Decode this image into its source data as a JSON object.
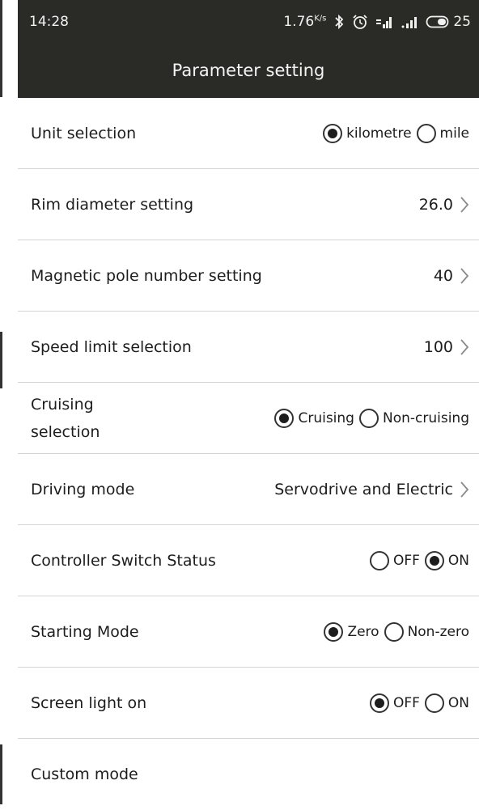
{
  "status_bar": {
    "time": "14:28",
    "speed": "1.76",
    "speed_unit": "K/s",
    "battery": "25",
    "icons": [
      "bluetooth-icon",
      "alarm-icon",
      "signal-icon",
      "signal-icon",
      "battery-icon"
    ]
  },
  "header": {
    "title": "Parameter setting"
  },
  "settings": {
    "unit": {
      "label": "Unit selection",
      "options": [
        "kilometre",
        "mile"
      ],
      "selected": "kilometre"
    },
    "rim": {
      "label": "Rim diameter setting",
      "value": "26.0"
    },
    "pole": {
      "label": "Magnetic pole number setting",
      "value": "40"
    },
    "speed": {
      "label": "Speed limit selection",
      "value": "100"
    },
    "cruise": {
      "label_line1": "Cruising",
      "label_line2": "selection",
      "options": [
        "Cruising",
        "Non-cruising"
      ],
      "selected": "Cruising"
    },
    "driving": {
      "label": "Driving mode",
      "value": "Servodrive and Electric"
    },
    "controller": {
      "label": "Controller Switch Status",
      "options": [
        "OFF",
        "ON"
      ],
      "selected": "ON"
    },
    "starting": {
      "label": "Starting Mode",
      "options": [
        "Zero",
        "Non-zero"
      ],
      "selected": "Zero"
    },
    "screen": {
      "label": "Screen light on",
      "options": [
        "OFF",
        "ON"
      ],
      "selected": "OFF"
    },
    "custom": {
      "label": "Custom mode"
    }
  },
  "colors": {
    "bar": "#2a2a27",
    "divider": "#d4d4d4",
    "text": "#1d1d1d"
  }
}
